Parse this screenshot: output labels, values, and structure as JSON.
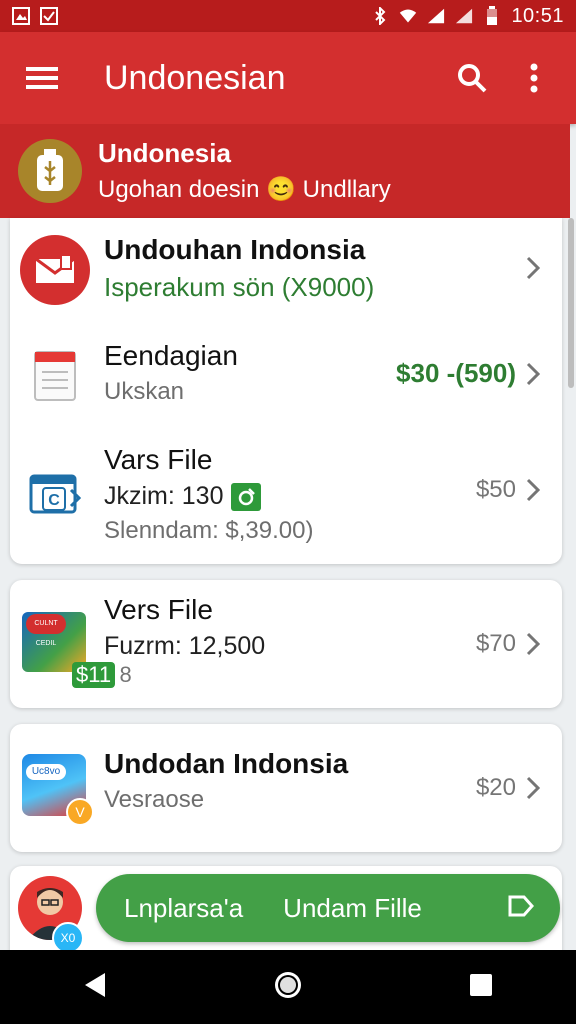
{
  "status_bar": {
    "time": "10:51",
    "icons": [
      "image-icon",
      "check-box-icon",
      "bluetooth-icon",
      "wifi-icon",
      "signal-icon",
      "signal-icon",
      "battery-icon"
    ]
  },
  "app_bar": {
    "title": "Undonesian",
    "actions": [
      "search-icon",
      "more-vert-icon"
    ]
  },
  "banner": {
    "title": "Undonesia",
    "subtitle": "Ugohan doesin 😊 Undllary"
  },
  "list": [
    {
      "title": "Undouhan Indonsia",
      "subtitle": "Isperakum sön  (X9000)",
      "icon": "envelope-icon"
    },
    {
      "title": "Eendagian",
      "subtitle": "Ukskan",
      "price": "$30 -(590)",
      "icon": "calendar-icon"
    },
    {
      "title": "Vars File",
      "subtitle": "Jkzim: 130",
      "subtitle2": "Slenndam: $,39.00)",
      "price": "$50",
      "icon": "folder-c-icon"
    }
  ],
  "card2": {
    "title": "Vers File",
    "subtitle": "Fuzrm: 12,500",
    "badge": "$11",
    "badge_count": "8",
    "price": "$70",
    "icon": "photo-thumbnail-icon",
    "thumb_text": "CULNT CEDIL"
  },
  "card3": {
    "title": "Undodan Indonsia",
    "subtitle": "Vesraose",
    "price": "$20",
    "icon": "photo-thumbnail-icon",
    "thumb_text": "Uc8vo",
    "thumb_badge": "V"
  },
  "bottom": {
    "fab_left": "Lnplarsа'a",
    "fab_right": "Undam Fille",
    "avatar_badge": "X0"
  },
  "colors": {
    "primary": "#d32f2f",
    "primary_dark": "#b71c1c",
    "accent_green": "#43a047"
  }
}
